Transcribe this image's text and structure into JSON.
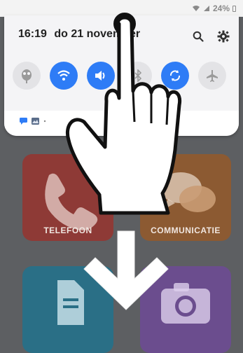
{
  "status_bar": {
    "battery": "24%"
  },
  "header": {
    "time": "16:19",
    "date": "do 21 november"
  },
  "quick_settings": {
    "toggles": [
      {
        "name": "dnd-toggle",
        "on": false
      },
      {
        "name": "wifi-toggle",
        "on": true
      },
      {
        "name": "sound-toggle",
        "on": true
      },
      {
        "name": "bluetooth-toggle",
        "on": false
      },
      {
        "name": "autorotate-toggle",
        "on": true
      },
      {
        "name": "airplane-toggle",
        "on": false
      }
    ]
  },
  "apps": [
    {
      "label": "TELEFOON",
      "color": "#8e3a36"
    },
    {
      "label": "COMMUNICATIE",
      "color": "#8c5a32"
    },
    {
      "label": "",
      "color": "#2a6f86"
    },
    {
      "label": "",
      "color": "#6b4d8e"
    }
  ],
  "colors": {
    "accent": "#2e7cf6"
  }
}
